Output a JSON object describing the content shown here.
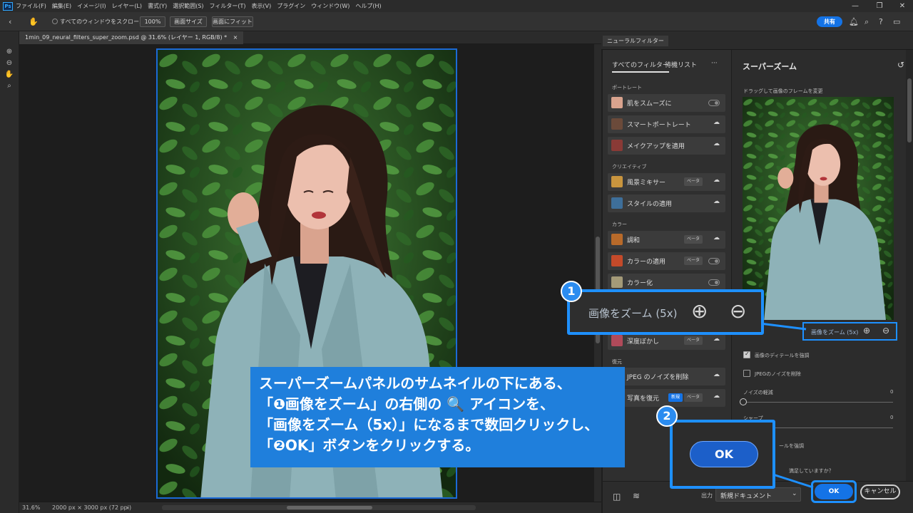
{
  "app": {
    "logo": "Ps",
    "menu": [
      "ファイル(F)",
      "編集(E)",
      "イメージ(I)",
      "レイヤー(L)",
      "書式(Y)",
      "選択範囲(S)",
      "フィルター(T)",
      "表示(V)",
      "プラグイン",
      "ウィンドウ(W)",
      "ヘルプ(H)"
    ],
    "window_controls": [
      "—",
      "❐",
      "✕"
    ]
  },
  "options": {
    "scroll_all_label": "すべてのウィンドウをスクロール",
    "zoom_100": "100%",
    "fit_screen_size": "画面サイズ",
    "fit_screen": "画面にフィット",
    "share_label": "共有"
  },
  "document": {
    "tab_title": "1min_09_neural_filters_super_zoom.psd @ 31.6% (レイヤー 1, RGB/8) *",
    "tab_close": "×",
    "zoom_readout": "31.6%",
    "doc_info": "2000 px × 3000 px (72 ppi)",
    "status_arrow": "›"
  },
  "neural_filters": {
    "panel_title": "ニューラルフィルター",
    "tabs": {
      "all": "すべてのフィルター",
      "waitlist": "待機リスト",
      "more": "···"
    },
    "categories": {
      "portrait": "ポートレート",
      "creative": "クリエイティブ",
      "color": "カラー",
      "restore": "復元"
    },
    "items": [
      {
        "label": "肌をスムーズに",
        "control": "toggle"
      },
      {
        "label": "スマートポートレート",
        "control": "cloud"
      },
      {
        "label": "メイクアップを適用",
        "control": "cloud"
      },
      {
        "label": "風景ミキサー",
        "badge": "ベータ",
        "control": "cloud"
      },
      {
        "label": "スタイルの適用",
        "control": "cloud"
      },
      {
        "label": "調和",
        "badge": "ベータ",
        "control": "cloud"
      },
      {
        "label": "カラーの適用",
        "badge": "ベータ",
        "control": "toggle"
      },
      {
        "label": "カラー化",
        "control": "toggle"
      },
      {
        "label": "深度ぼかし",
        "badge": "ベータ",
        "control": "cloud"
      },
      {
        "label": "JPEG のノイズを削除",
        "control": "cloud"
      },
      {
        "label": "写真を復元",
        "badge_new": "新規",
        "badge": "ベータ",
        "control": "cloud"
      }
    ]
  },
  "super_zoom": {
    "title": "スーパーズーム",
    "reset_icon": "↺",
    "drag_hint": "ドラッグして画像のフレームを変更",
    "zoom_label": "画像をズーム (5x)",
    "zoom_label_callout": "画像をズーム (5x)",
    "enhance_detail": "画像のディテールを強調",
    "remove_jpeg_noise": "JPEGのノイズを削除",
    "noise_level_label": "ノイズの軽減",
    "noise_level_value": "0",
    "sharpen_label": "シャープ",
    "sharpen_value": "0",
    "enhance_face_partial": "ールを強調",
    "satisfied_partial": "満足していますか？"
  },
  "footer": {
    "output_label": "出力",
    "output_value": "新規ドキュメント",
    "ok_label": "OK",
    "cancel_label": "キャンセル"
  },
  "annotations": {
    "step1": "1",
    "step2": "2",
    "ok_big": "OK",
    "instruction_lines": [
      "スーパーズームパネルのサムネイルの下にある、",
      "「❶画像をズーム」の右側の 🔍 アイコンを、",
      "「画像をズーム（5x）」になるまで数回クリックし、",
      "「❷OK」ボタンをクリックする。"
    ]
  },
  "colors": {
    "accent": "#1e90ff",
    "instruction_bg": "#1f7fdc",
    "ok_blue": "#1473e6"
  }
}
